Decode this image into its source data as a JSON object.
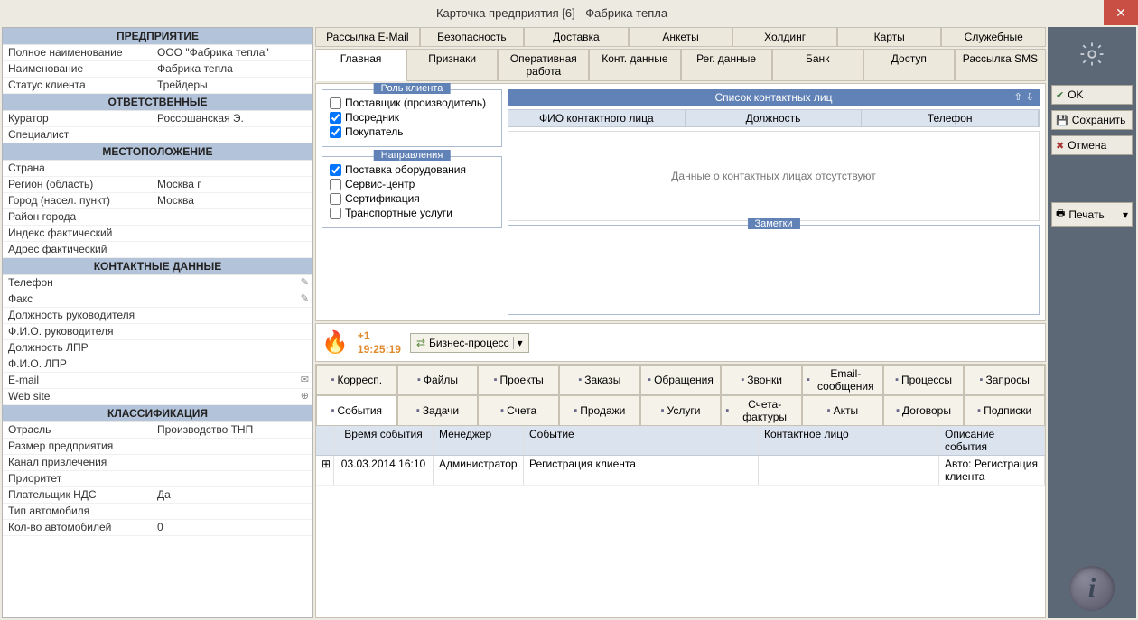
{
  "window": {
    "title": "Карточка предприятия [6] - Фабрика тепла"
  },
  "left": {
    "sections": [
      {
        "title": "ПРЕДПРИЯТИЕ",
        "rows": [
          {
            "label": "Полное наименование",
            "value": "ООО \"Фабрика тепла\""
          },
          {
            "label": "Наименование",
            "value": "Фабрика тепла"
          },
          {
            "label": "Статус клиента",
            "value": "Трейдеры"
          }
        ]
      },
      {
        "title": "ОТВЕТСТВЕННЫЕ",
        "rows": [
          {
            "label": "Куратор",
            "value": "Россошанская Э."
          },
          {
            "label": "Специалист",
            "value": ""
          }
        ]
      },
      {
        "title": "МЕСТОПОЛОЖЕНИЕ",
        "rows": [
          {
            "label": "Страна",
            "value": ""
          },
          {
            "label": "Регион (область)",
            "value": "Москва г"
          },
          {
            "label": "Город (насел. пункт)",
            "value": "Москва"
          },
          {
            "label": "Район города",
            "value": ""
          },
          {
            "label": "Индекс фактический",
            "value": ""
          },
          {
            "label": "Адрес фактический",
            "value": ""
          }
        ]
      },
      {
        "title": "КОНТАКТНЫЕ ДАННЫЕ",
        "rows": [
          {
            "label": "Телефон",
            "value": "",
            "icon": "phone"
          },
          {
            "label": "Факс",
            "value": "",
            "icon": "phone"
          },
          {
            "label": "Должность руководителя",
            "value": ""
          },
          {
            "label": "Ф.И.О. руководителя",
            "value": ""
          },
          {
            "label": "Должность ЛПР",
            "value": ""
          },
          {
            "label": "Ф.И.О. ЛПР",
            "value": ""
          },
          {
            "label": "E-mail",
            "value": "",
            "icon": "mail"
          },
          {
            "label": "Web site",
            "value": "",
            "icon": "globe"
          }
        ]
      },
      {
        "title": "КЛАССИФИКАЦИЯ",
        "rows": [
          {
            "label": "Отрасль",
            "value": "Производство ТНП"
          },
          {
            "label": "Размер предприятия",
            "value": ""
          },
          {
            "label": "Канал привлечения",
            "value": ""
          },
          {
            "label": "Приоритет",
            "value": ""
          },
          {
            "label": "Плательщик НДС",
            "value": "Да"
          },
          {
            "label": "Тип автомобиля",
            "value": ""
          },
          {
            "label": "Кол-во автомобилей",
            "value": "0"
          }
        ]
      }
    ]
  },
  "topTabs1": [
    "Рассылка E-Mail",
    "Безопасность",
    "Доставка",
    "Анкеты",
    "Холдинг",
    "Карты",
    "Служебные"
  ],
  "topTabs2": [
    "Главная",
    "Признаки",
    "Оперативная работа",
    "Конт. данные",
    "Рег. данные",
    "Банк",
    "Доступ",
    "Рассылка SMS"
  ],
  "activeTab": "Главная",
  "role": {
    "title": "Роль клиента",
    "items": [
      {
        "label": "Поставщик (производитель)",
        "checked": false
      },
      {
        "label": "Посредник",
        "checked": true
      },
      {
        "label": "Покупатель",
        "checked": true
      }
    ]
  },
  "directions": {
    "title": "Направления",
    "items": [
      {
        "label": "Поставка оборудования",
        "checked": true
      },
      {
        "label": "Сервис-центр",
        "checked": false
      },
      {
        "label": "Сертификация",
        "checked": false
      },
      {
        "label": "Транспортные услуги",
        "checked": false
      }
    ]
  },
  "contacts": {
    "title": "Список контактных лиц",
    "columns": [
      "ФИО контактного лица",
      "Должность",
      "Телефон"
    ],
    "empty": "Данные о контактных лицах отсутствуют"
  },
  "notes": {
    "title": "Заметки",
    "value": ""
  },
  "fire": {
    "counter": "+1",
    "time": "19:25:19",
    "bp": "Бизнес-процесс"
  },
  "bottomTabs1": [
    "Корресп.",
    "Файлы",
    "Проекты",
    "Заказы",
    "Обращения",
    "Звонки",
    "Email-сообщения",
    "Процессы",
    "Запросы"
  ],
  "bottomTabs2": [
    "События",
    "Задачи",
    "Счета",
    "Продажи",
    "Услуги",
    "Счета-фактуры",
    "Акты",
    "Договоры",
    "Подписки"
  ],
  "activeBottomTab": "События",
  "events": {
    "columns": [
      "Время события",
      "Менеджер",
      "Событие",
      "Контактное лицо",
      "Описание события"
    ],
    "rows": [
      {
        "time": "03.03.2014 16:10",
        "manager": "Администратор",
        "event": "Регистрация клиента",
        "contact": "",
        "desc": "Авто: Регистрация клиента"
      }
    ]
  },
  "sideButtons": {
    "ok": "OK",
    "save": "Сохранить",
    "cancel": "Отмена",
    "print": "Печать"
  }
}
